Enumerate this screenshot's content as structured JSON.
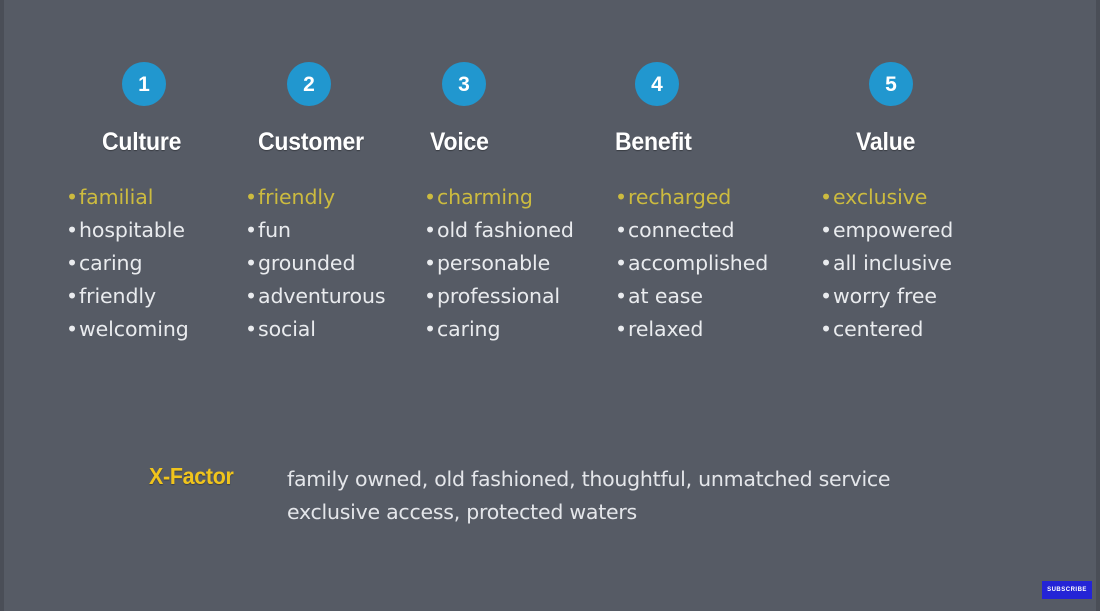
{
  "slide": {
    "background_color": "#565b65",
    "edge_color": "#4a4e57",
    "badge_color": "#2197cf",
    "heading_color": "#ffffff",
    "item_color": "#e9ebee",
    "highlight_color": "#ccbb3f",
    "xfactor_color": "#f0c41c"
  },
  "columns": [
    {
      "number": "1",
      "heading": "Culture",
      "items": [
        {
          "text": "familial",
          "highlight": true
        },
        {
          "text": "hospitable",
          "highlight": false
        },
        {
          "text": "caring",
          "highlight": false
        },
        {
          "text": "friendly",
          "highlight": false
        },
        {
          "text": "welcoming",
          "highlight": false
        }
      ]
    },
    {
      "number": "2",
      "heading": "Customer",
      "items": [
        {
          "text": "friendly",
          "highlight": true
        },
        {
          "text": "fun",
          "highlight": false
        },
        {
          "text": "grounded",
          "highlight": false
        },
        {
          "text": "adventurous",
          "highlight": false
        },
        {
          "text": "social",
          "highlight": false
        }
      ]
    },
    {
      "number": "3",
      "heading": "Voice",
      "items": [
        {
          "text": "charming",
          "highlight": true
        },
        {
          "text": "old fashioned",
          "highlight": false
        },
        {
          "text": "personable",
          "highlight": false
        },
        {
          "text": "professional",
          "highlight": false
        },
        {
          "text": "caring",
          "highlight": false
        }
      ]
    },
    {
      "number": "4",
      "heading": "Benefit",
      "items": [
        {
          "text": "recharged",
          "highlight": true
        },
        {
          "text": "connected",
          "highlight": false
        },
        {
          "text": "accomplished",
          "highlight": false
        },
        {
          "text": "at ease",
          "highlight": false
        },
        {
          "text": "relaxed",
          "highlight": false
        }
      ]
    },
    {
      "number": "5",
      "heading": "Value",
      "items": [
        {
          "text": "exclusive",
          "highlight": true
        },
        {
          "text": "empowered",
          "highlight": false
        },
        {
          "text": "all inclusive",
          "highlight": false
        },
        {
          "text": "worry free",
          "highlight": false
        },
        {
          "text": "centered",
          "highlight": false
        }
      ]
    }
  ],
  "xfactor": {
    "label": "X-Factor",
    "lines": [
      "family owned, old fashioned, thoughtful, unmatched service",
      "exclusive access, protected waters"
    ]
  },
  "overlay": {
    "subscribe_label": "SUBSCRIBE"
  },
  "bullet_glyph": "•"
}
